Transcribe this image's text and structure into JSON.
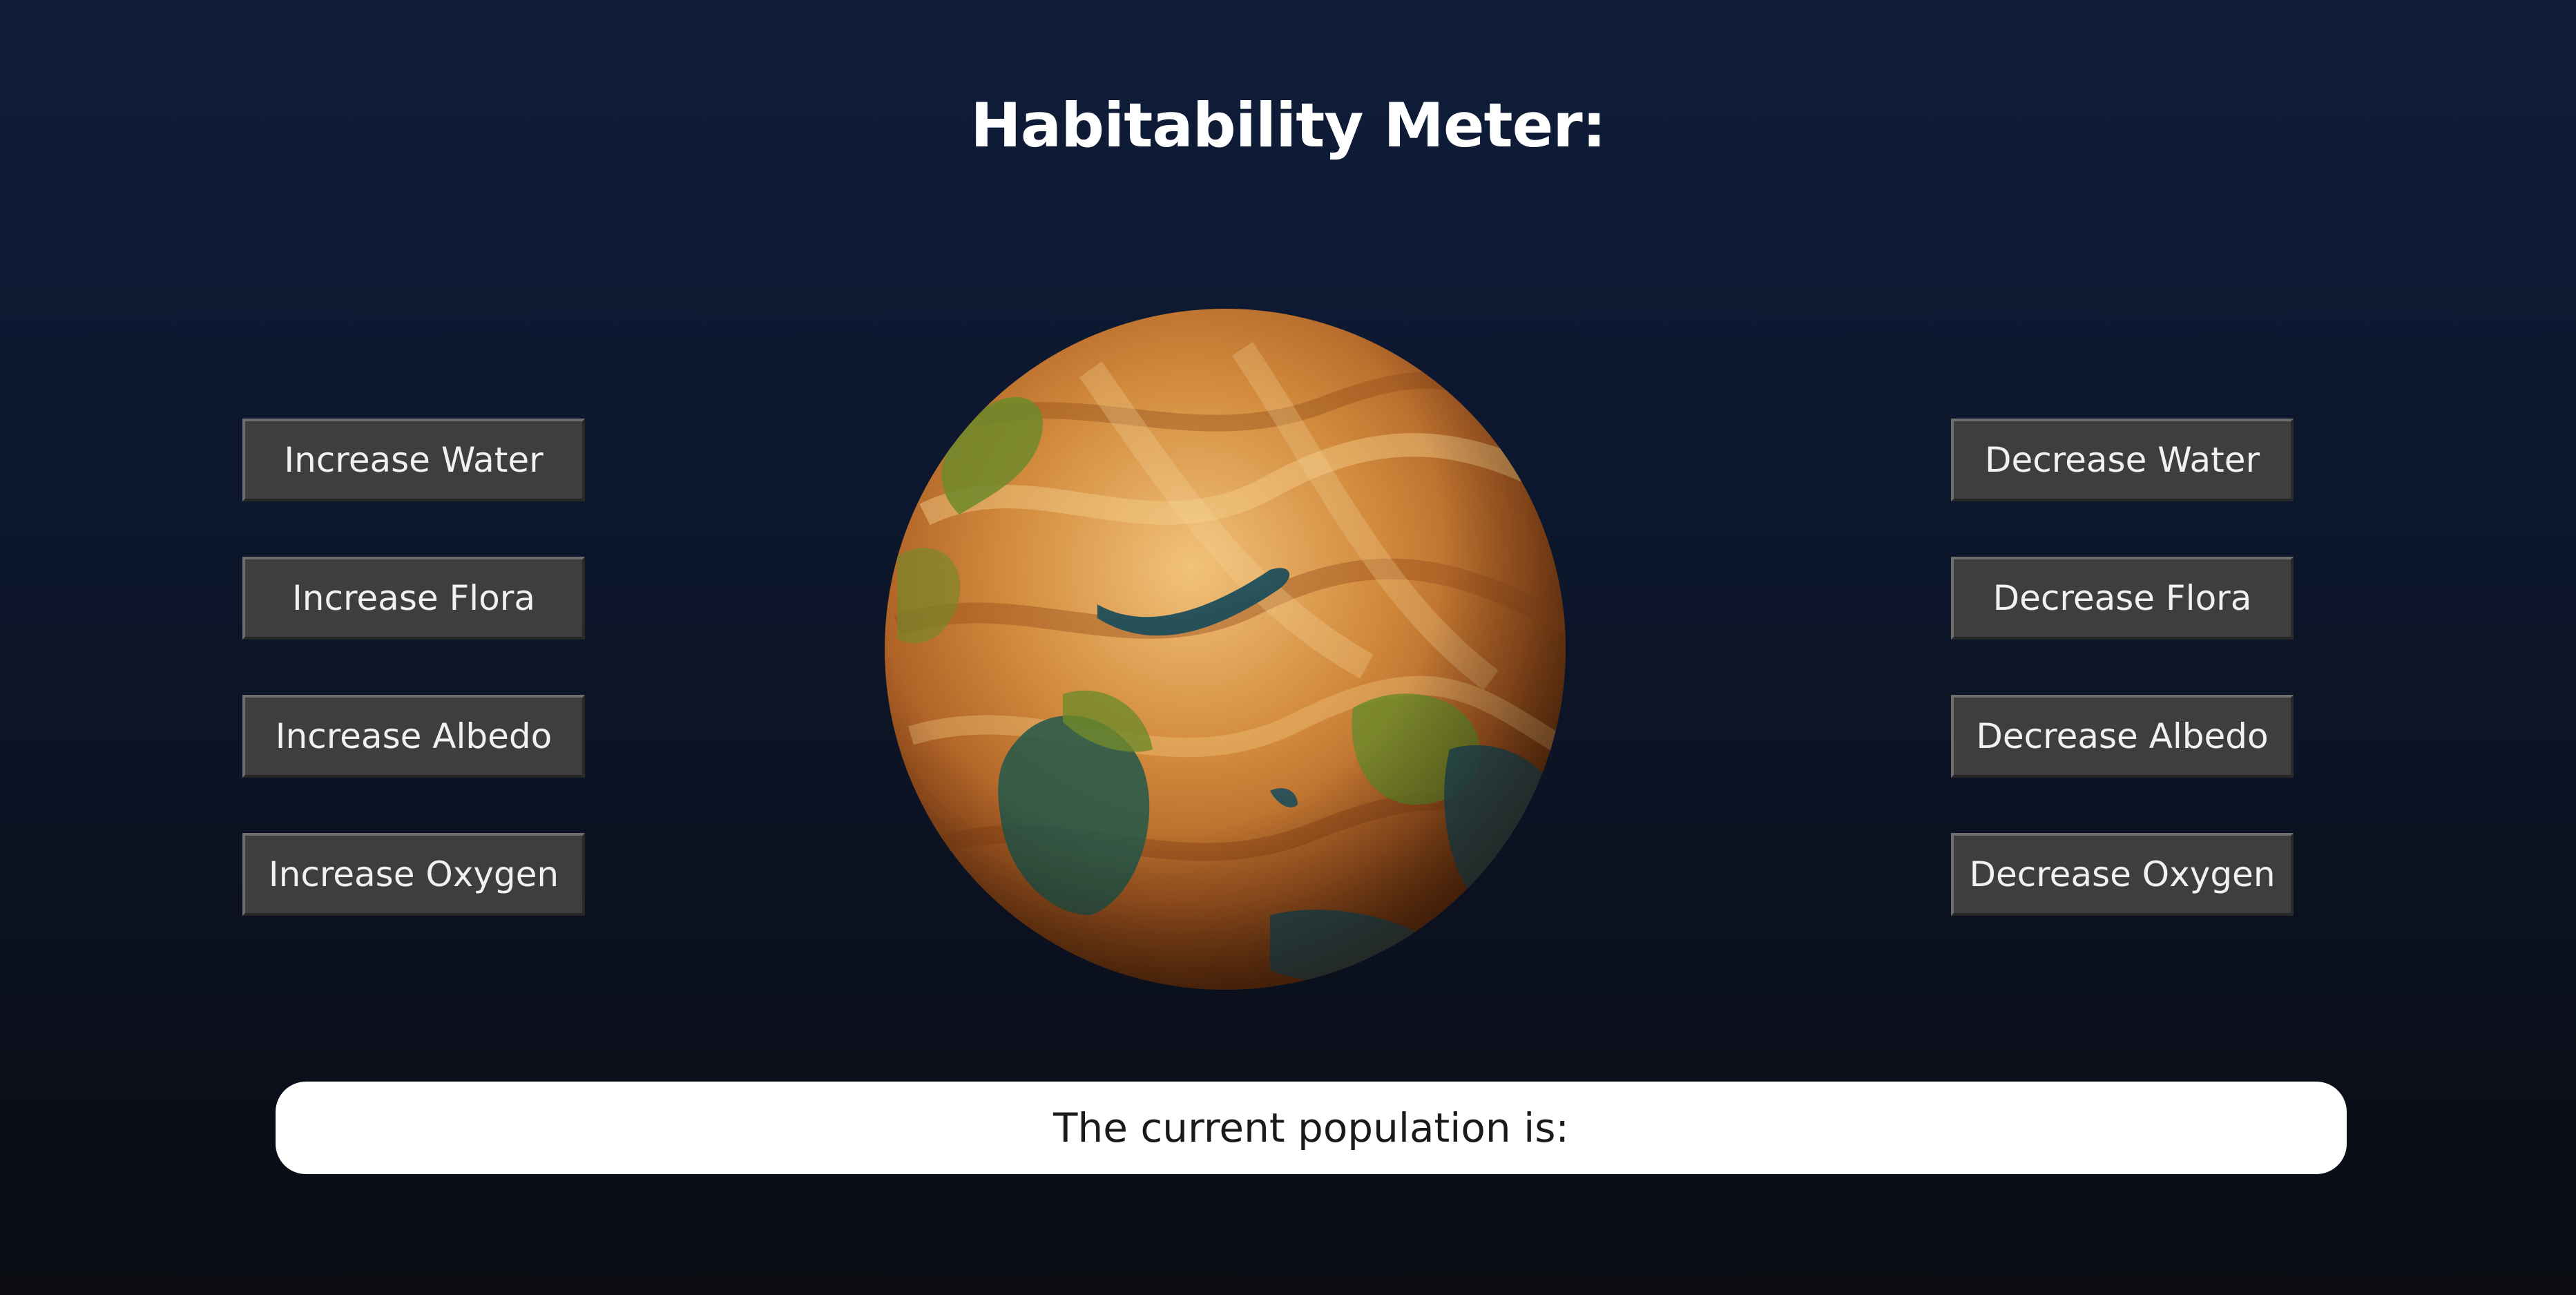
{
  "header": {
    "title": "Habitability Meter:"
  },
  "controls": {
    "increase": [
      {
        "label": "Increase Water"
      },
      {
        "label": "Increase Flora"
      },
      {
        "label": "Increase Albedo"
      },
      {
        "label": "Increase Oxygen"
      }
    ],
    "decrease": [
      {
        "label": "Decrease Water"
      },
      {
        "label": "Decrease Flora"
      },
      {
        "label": "Decrease Albedo"
      },
      {
        "label": "Decrease Oxygen"
      }
    ]
  },
  "planet": {
    "icon": "planet-globe",
    "colors": {
      "surface": "#c8782e",
      "highlight": "#f1c27a",
      "shadow": "#6b3410",
      "vegetation": "#6f8a2a",
      "water": "#1f4e5a"
    }
  },
  "status": {
    "population_label": "The current population is:"
  },
  "theme": {
    "background_top": "#0f1d3a",
    "background_bottom": "#0a0c12",
    "button_fill": "#3e3e3e",
    "button_text": "#f1f1f1"
  }
}
